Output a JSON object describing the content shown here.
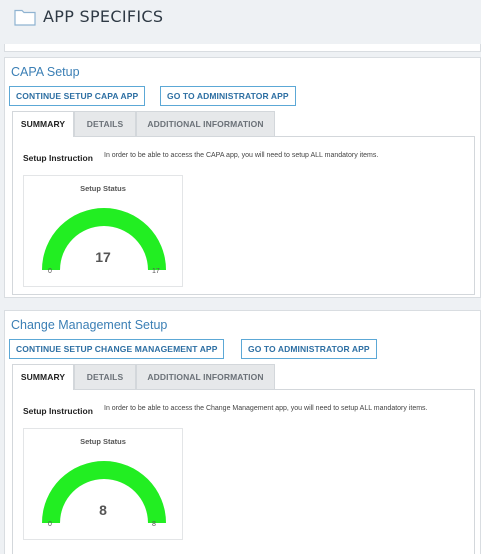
{
  "header": {
    "title": "APP SPECIFICS",
    "icon": "folder-icon"
  },
  "colors": {
    "accent": "#3b7fb5",
    "gauge_fill": "#22ee22"
  },
  "sections": [
    {
      "title": "CAPA Setup",
      "continue_label": "CONTINUE SETUP CAPA APP",
      "admin_label": "GO TO ADMINISTRATOR APP",
      "tabs": [
        "SUMMARY",
        "DETAILS",
        "ADDITIONAL INFORMATION"
      ],
      "active_tab": "SUMMARY",
      "instruction_label": "Setup Instruction",
      "instruction_text": "In order to be able to access the CAPA app, you will need to setup ALL mandatory items.",
      "gauge": {
        "title": "Setup Status",
        "value": 17,
        "min": 0,
        "max": 17
      }
    },
    {
      "title": "Change Management Setup",
      "continue_label": "CONTINUE SETUP CHANGE MANAGEMENT APP",
      "admin_label": "GO TO ADMINISTRATOR APP",
      "tabs": [
        "SUMMARY",
        "DETAILS",
        "ADDITIONAL INFORMATION"
      ],
      "active_tab": "SUMMARY",
      "instruction_label": "Setup Instruction",
      "instruction_text": "In order to be able to access the Change Management app, you will need to setup ALL mandatory items.",
      "gauge": {
        "title": "Setup Status",
        "value": 8,
        "min": 0,
        "max": 8
      }
    }
  ]
}
